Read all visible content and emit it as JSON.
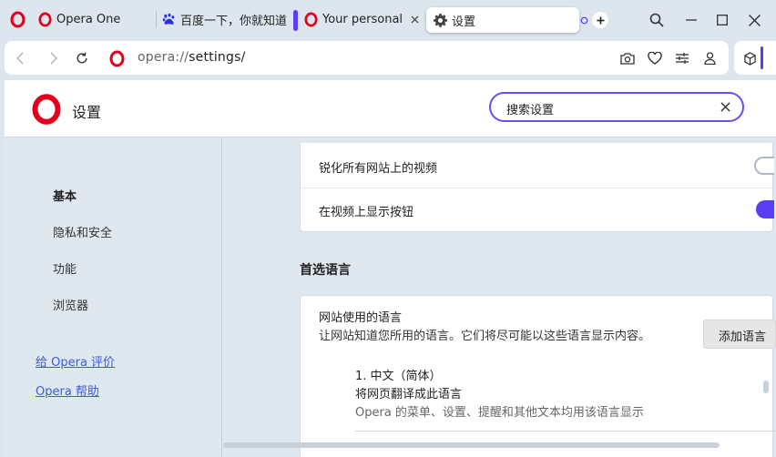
{
  "tabs": [
    {
      "title": "Opera One",
      "icon": "opera-icon"
    },
    {
      "title": "百度一下，你就知道",
      "icon": "baidu-paw-icon"
    },
    {
      "title": "Your personal b",
      "icon": "opera-icon"
    },
    {
      "title": "设置",
      "icon": "gear-icon",
      "active": true
    }
  ],
  "window_controls": {
    "search": "search-icon",
    "minimize": "minimize-icon",
    "maximize": "maximize-icon",
    "close": "close-icon"
  },
  "address_bar": {
    "scheme": "opera://",
    "path": "settings/",
    "actions": [
      "camera-icon",
      "heart-icon",
      "easy-setup-icon",
      "profile-icon"
    ],
    "extension": "cube-icon"
  },
  "settings": {
    "title": "设置",
    "search_value": "搜索设置"
  },
  "sidebar": {
    "items": [
      {
        "label": "基本",
        "active": true
      },
      {
        "label": "隐私和安全"
      },
      {
        "label": "功能"
      },
      {
        "label": "浏览器"
      }
    ],
    "links": [
      {
        "label": "给 Opera 评价"
      },
      {
        "label": "Opera 帮助"
      }
    ]
  },
  "video_card": {
    "rows": [
      {
        "label": "锐化所有网站上的视频",
        "toggle": "off"
      },
      {
        "label": "在视频上显示按钮",
        "toggle": "on"
      }
    ]
  },
  "preferred_language": {
    "section_title": "首选语言",
    "heading": "网站使用的语言",
    "description": "让网站知道您所用的语言。它们将尽可能以这些语言显示内容。",
    "add_button": "添加语言",
    "languages": [
      {
        "name": "1. 中文（简体）",
        "translate_note": "将网页翻译成此语言",
        "ui_note": "Opera 的菜单、设置、提醒和其他文本均用该语言显示"
      }
    ]
  },
  "colors": {
    "accent": "#5b3ef2",
    "opera_red": "#e3001b",
    "link": "#3d5bd8",
    "frame": "#dde6ee"
  }
}
